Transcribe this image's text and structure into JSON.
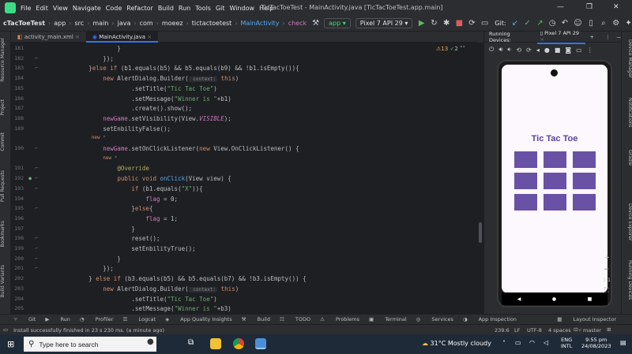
{
  "titlebar": {
    "menu": [
      "File",
      "Edit",
      "View",
      "Navigate",
      "Code",
      "Refactor",
      "Build",
      "Run",
      "Tools",
      "Git",
      "Window",
      "Help"
    ],
    "window_title": "TicTacToeTest - MainActivity.java [TicTacToeTest.app.main]"
  },
  "navbar": {
    "crumbs": [
      "cTacToeTest",
      "app",
      "src",
      "main",
      "java",
      "com",
      "moeez",
      "tictactoetest"
    ],
    "class_crumb": "MainActivity",
    "method_crumb": "check",
    "run_config": "app",
    "device": "Pixel 7 API 29",
    "git": "Git:"
  },
  "tabs": [
    "activity_main.xml",
    "MainActivity.java"
  ],
  "left_tools": [
    "Resource Manager",
    "Project",
    "Commit",
    "Pull Requests",
    "Bookmarks",
    "Build Variants"
  ],
  "right_tools": [
    "Device Manager",
    "Notifications",
    "Gradle",
    "Device Explorer",
    "Running Devices"
  ],
  "editor": {
    "inspections": {
      "warnings": "13",
      "weak": "2"
    },
    "lines": [
      {
        "n": "181",
        "t": "                    }"
      },
      {
        "n": "182",
        "t": "                });"
      },
      {
        "n": "183",
        "t": "            }else if (b1.equals(b5) && b5.equals(b9) && !b1.isEmpty()){"
      },
      {
        "n": "184",
        "t": "                new AlertDialog.Builder( context: this)"
      },
      {
        "n": "185",
        "t": "                        .setTitle(\"Tic Tac Toe\")"
      },
      {
        "n": "186",
        "t": "                        .setMessage(\"Winner is \"+b1)"
      },
      {
        "n": "187",
        "t": "                        .create().show();"
      },
      {
        "n": "188",
        "t": "                newGame.setVisibility(View.VISIBLE);"
      },
      {
        "n": "189",
        "t": "                setEnbilityFalse();"
      },
      {
        "n": "",
        "t": "                new *"
      },
      {
        "n": "190",
        "t": "                newGame.setOnClickListener(new View.OnClickListener() {"
      },
      {
        "n": "",
        "t": "                    new *"
      },
      {
        "n": "191",
        "t": "                    @Override"
      },
      {
        "n": "192",
        "t": "                    public void onClick(View view) {"
      },
      {
        "n": "193",
        "t": "                        if (b1.equals(\"X\")){"
      },
      {
        "n": "194",
        "t": "                            flag = 0;"
      },
      {
        "n": "195",
        "t": "                        }else{"
      },
      {
        "n": "196",
        "t": "                            flag = 1;"
      },
      {
        "n": "197",
        "t": "                        }"
      },
      {
        "n": "198",
        "t": "                        reset();"
      },
      {
        "n": "199",
        "t": "                        setEnbilityTrue();"
      },
      {
        "n": "200",
        "t": "                    }"
      },
      {
        "n": "201",
        "t": "                });"
      },
      {
        "n": "202",
        "t": "            } else if (b3.equals(b5) && b5.equals(b7) && !b3.isEmpty()) {"
      },
      {
        "n": "203",
        "t": "                new AlertDialog.Builder( context: this)"
      },
      {
        "n": "204",
        "t": "                        .setTitle(\"Tic Tac Toe\")"
      },
      {
        "n": "205",
        "t": "                        .setMessage(\"Winner is \"+b3)"
      }
    ]
  },
  "running_devices": {
    "label": "Running Devices:",
    "device": "Pixel 7 API 29",
    "zoom_ratio": "1:1"
  },
  "phone": {
    "app_title": "Tic Tac Toe"
  },
  "toolwindows": [
    "Git",
    "Run",
    "Profiler",
    "Logcat",
    "App Quality Insights",
    "Build",
    "TODO",
    "Problems",
    "Terminal",
    "Services",
    "App Inspection",
    "Layout Inspector"
  ],
  "status": {
    "message": "Install successfully finished in 23 s 230 ms. (a minute ago)",
    "position": "239:6",
    "line_sep": "LF",
    "encoding": "UTF-8",
    "indent": "4 spaces",
    "branch": "master"
  },
  "taskbar": {
    "search_placeholder": "Type here to search",
    "weather": "31°C  Mostly cloudy",
    "lang1": "ENG",
    "lang2": "INTL",
    "time": "9:55 pm",
    "date": "24/08/2023"
  }
}
